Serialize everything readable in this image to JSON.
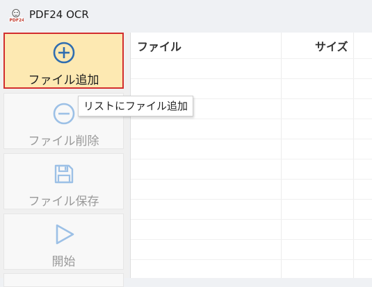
{
  "window": {
    "title": "PDF24 OCR",
    "icon": "pdf24-logo-icon"
  },
  "toolbar": {
    "buttons": [
      {
        "label": "ファイル追加",
        "icon": "plus-circle-icon",
        "active": true
      },
      {
        "label": "ファイル削除",
        "icon": "minus-circle-icon",
        "active": false
      },
      {
        "label": "ファイル保存",
        "icon": "floppy-disk-icon",
        "active": false
      },
      {
        "label": "開始",
        "icon": "play-triangle-icon",
        "active": false
      }
    ]
  },
  "tooltip": {
    "text": "リストにファイル追加"
  },
  "file_list": {
    "columns": [
      {
        "label": "ファイル"
      },
      {
        "label": "サイズ"
      }
    ],
    "rows": []
  },
  "colors": {
    "active_bg": "#fde9b2",
    "active_border": "#d22d2d",
    "icon_active": "#2f6db0",
    "icon_disabled": "#9cc0e6"
  }
}
